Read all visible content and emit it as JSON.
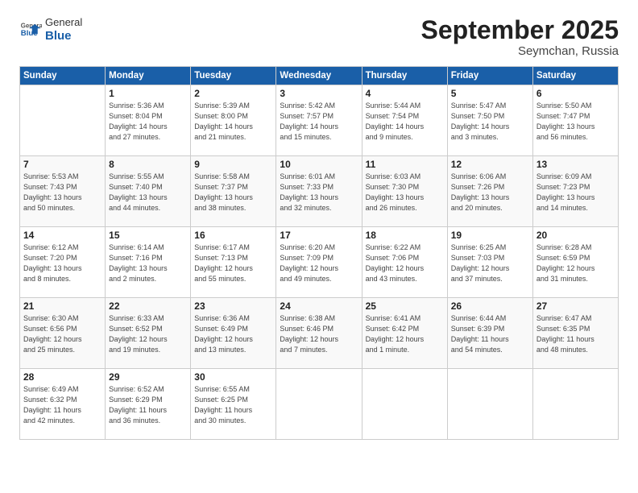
{
  "header": {
    "logo_general": "General",
    "logo_blue": "Blue",
    "month_title": "September 2025",
    "location": "Seymchan, Russia"
  },
  "days_of_week": [
    "Sunday",
    "Monday",
    "Tuesday",
    "Wednesday",
    "Thursday",
    "Friday",
    "Saturday"
  ],
  "weeks": [
    [
      {
        "day": "",
        "info": ""
      },
      {
        "day": "1",
        "info": "Sunrise: 5:36 AM\nSunset: 8:04 PM\nDaylight: 14 hours\nand 27 minutes."
      },
      {
        "day": "2",
        "info": "Sunrise: 5:39 AM\nSunset: 8:00 PM\nDaylight: 14 hours\nand 21 minutes."
      },
      {
        "day": "3",
        "info": "Sunrise: 5:42 AM\nSunset: 7:57 PM\nDaylight: 14 hours\nand 15 minutes."
      },
      {
        "day": "4",
        "info": "Sunrise: 5:44 AM\nSunset: 7:54 PM\nDaylight: 14 hours\nand 9 minutes."
      },
      {
        "day": "5",
        "info": "Sunrise: 5:47 AM\nSunset: 7:50 PM\nDaylight: 14 hours\nand 3 minutes."
      },
      {
        "day": "6",
        "info": "Sunrise: 5:50 AM\nSunset: 7:47 PM\nDaylight: 13 hours\nand 56 minutes."
      }
    ],
    [
      {
        "day": "7",
        "info": "Sunrise: 5:53 AM\nSunset: 7:43 PM\nDaylight: 13 hours\nand 50 minutes."
      },
      {
        "day": "8",
        "info": "Sunrise: 5:55 AM\nSunset: 7:40 PM\nDaylight: 13 hours\nand 44 minutes."
      },
      {
        "day": "9",
        "info": "Sunrise: 5:58 AM\nSunset: 7:37 PM\nDaylight: 13 hours\nand 38 minutes."
      },
      {
        "day": "10",
        "info": "Sunrise: 6:01 AM\nSunset: 7:33 PM\nDaylight: 13 hours\nand 32 minutes."
      },
      {
        "day": "11",
        "info": "Sunrise: 6:03 AM\nSunset: 7:30 PM\nDaylight: 13 hours\nand 26 minutes."
      },
      {
        "day": "12",
        "info": "Sunrise: 6:06 AM\nSunset: 7:26 PM\nDaylight: 13 hours\nand 20 minutes."
      },
      {
        "day": "13",
        "info": "Sunrise: 6:09 AM\nSunset: 7:23 PM\nDaylight: 13 hours\nand 14 minutes."
      }
    ],
    [
      {
        "day": "14",
        "info": "Sunrise: 6:12 AM\nSunset: 7:20 PM\nDaylight: 13 hours\nand 8 minutes."
      },
      {
        "day": "15",
        "info": "Sunrise: 6:14 AM\nSunset: 7:16 PM\nDaylight: 13 hours\nand 2 minutes."
      },
      {
        "day": "16",
        "info": "Sunrise: 6:17 AM\nSunset: 7:13 PM\nDaylight: 12 hours\nand 55 minutes."
      },
      {
        "day": "17",
        "info": "Sunrise: 6:20 AM\nSunset: 7:09 PM\nDaylight: 12 hours\nand 49 minutes."
      },
      {
        "day": "18",
        "info": "Sunrise: 6:22 AM\nSunset: 7:06 PM\nDaylight: 12 hours\nand 43 minutes."
      },
      {
        "day": "19",
        "info": "Sunrise: 6:25 AM\nSunset: 7:03 PM\nDaylight: 12 hours\nand 37 minutes."
      },
      {
        "day": "20",
        "info": "Sunrise: 6:28 AM\nSunset: 6:59 PM\nDaylight: 12 hours\nand 31 minutes."
      }
    ],
    [
      {
        "day": "21",
        "info": "Sunrise: 6:30 AM\nSunset: 6:56 PM\nDaylight: 12 hours\nand 25 minutes."
      },
      {
        "day": "22",
        "info": "Sunrise: 6:33 AM\nSunset: 6:52 PM\nDaylight: 12 hours\nand 19 minutes."
      },
      {
        "day": "23",
        "info": "Sunrise: 6:36 AM\nSunset: 6:49 PM\nDaylight: 12 hours\nand 13 minutes."
      },
      {
        "day": "24",
        "info": "Sunrise: 6:38 AM\nSunset: 6:46 PM\nDaylight: 12 hours\nand 7 minutes."
      },
      {
        "day": "25",
        "info": "Sunrise: 6:41 AM\nSunset: 6:42 PM\nDaylight: 12 hours\nand 1 minute."
      },
      {
        "day": "26",
        "info": "Sunrise: 6:44 AM\nSunset: 6:39 PM\nDaylight: 11 hours\nand 54 minutes."
      },
      {
        "day": "27",
        "info": "Sunrise: 6:47 AM\nSunset: 6:35 PM\nDaylight: 11 hours\nand 48 minutes."
      }
    ],
    [
      {
        "day": "28",
        "info": "Sunrise: 6:49 AM\nSunset: 6:32 PM\nDaylight: 11 hours\nand 42 minutes."
      },
      {
        "day": "29",
        "info": "Sunrise: 6:52 AM\nSunset: 6:29 PM\nDaylight: 11 hours\nand 36 minutes."
      },
      {
        "day": "30",
        "info": "Sunrise: 6:55 AM\nSunset: 6:25 PM\nDaylight: 11 hours\nand 30 minutes."
      },
      {
        "day": "",
        "info": ""
      },
      {
        "day": "",
        "info": ""
      },
      {
        "day": "",
        "info": ""
      },
      {
        "day": "",
        "info": ""
      }
    ]
  ]
}
